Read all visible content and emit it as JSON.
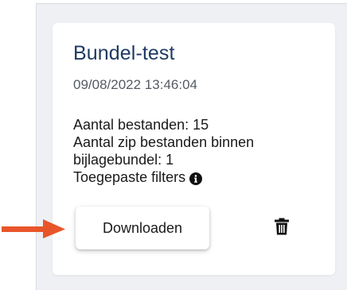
{
  "card": {
    "title": "Bundel-test",
    "date": "09/08/2022 13:46:04",
    "file_count": "Aantal bestanden: 15",
    "zip_count_line1": "Aantal zip bestanden binnen",
    "zip_count_line2": "bijlagebundel: 1",
    "filters_label": "Toegepaste filters",
    "download_label": "Downloaden"
  },
  "icons": {
    "info": "info-circle-icon",
    "delete": "trash-icon",
    "pointer": "arrow-right-icon"
  },
  "colors": {
    "title": "#1f3a63",
    "panel_background": "#eef0f4",
    "arrow": "#e8552a"
  }
}
